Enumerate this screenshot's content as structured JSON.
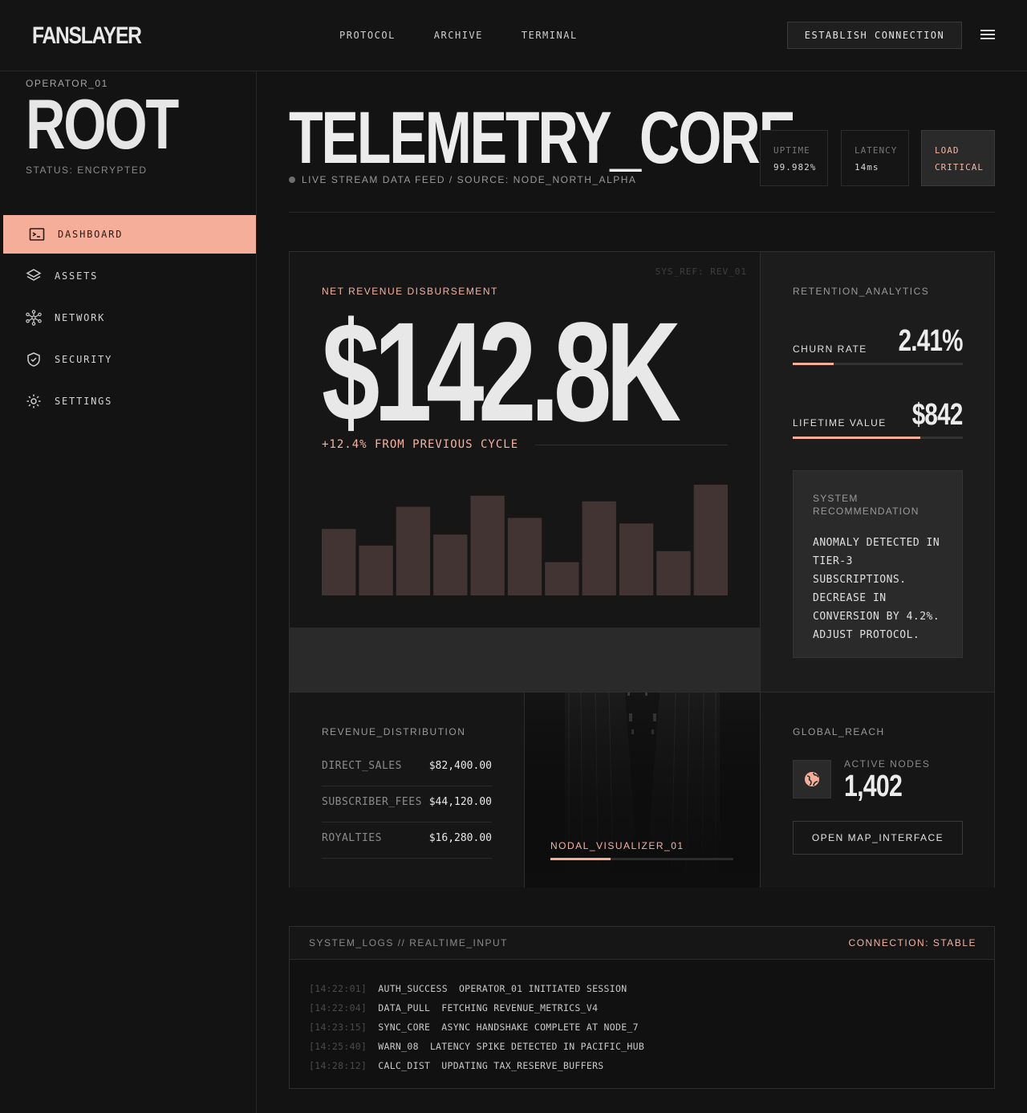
{
  "header": {
    "logo": "FANSLAYER",
    "nav": [
      "PROTOCOL",
      "ARCHIVE",
      "TERMINAL"
    ],
    "connect_label": "ESTABLISH CONNECTION"
  },
  "sidebar": {
    "operator": "OPERATOR_01",
    "role": "ROOT",
    "status": "STATUS: ENCRYPTED",
    "items": [
      {
        "label": "DASHBOARD",
        "icon": "terminal-icon",
        "active": true
      },
      {
        "label": "ASSETS",
        "icon": "layers-icon"
      },
      {
        "label": "NETWORK",
        "icon": "network-icon"
      },
      {
        "label": "SECURITY",
        "icon": "shield-icon"
      },
      {
        "label": "SETTINGS",
        "icon": "gear-icon"
      }
    ]
  },
  "main": {
    "title": "TELEMETRY_CORE",
    "subtitle": "LIVE STREAM DATA FEED / SOURCE: NODE_NORTH_ALPHA",
    "stats": [
      {
        "key": "UPTIME",
        "value": "99.982%"
      },
      {
        "key": "LATENCY",
        "value": "14ms"
      },
      {
        "key": "LOAD",
        "value": "CRITICAL",
        "alert": true
      }
    ]
  },
  "revenue": {
    "sys_ref": "SYS_REF: REV_01",
    "label": "NET REVENUE DISBURSEMENT",
    "value": "$142.8K",
    "change": "+12.4% FROM PREVIOUS CYCLE"
  },
  "chart_data": {
    "type": "bar",
    "values": [
      60,
      45,
      80,
      55,
      90,
      70,
      30,
      85,
      65,
      40,
      100
    ],
    "ylim": [
      0,
      100
    ]
  },
  "retention": {
    "label": "RETENTION_ANALYTICS",
    "churn": {
      "name": "CHURN RATE",
      "value": "2.41%",
      "fill": 0.24
    },
    "ltv": {
      "name": "LIFETIME VALUE",
      "value": "$842",
      "fill": 0.75
    },
    "rec_title": "SYSTEM RECOMMENDATION",
    "rec_text": "ANOMALY DETECTED IN TIER-3 SUBSCRIPTIONS. DECREASE IN CONVERSION BY 4.2%. ADJUST PROTOCOL."
  },
  "distribution": {
    "label": "REVENUE_DISTRIBUTION",
    "rows": [
      {
        "key": "DIRECT_SALES",
        "value": "$82,400.00"
      },
      {
        "key": "SUBSCRIBER_FEES",
        "value": "$44,120.00"
      },
      {
        "key": "ROYALTIES",
        "value": "$16,280.00"
      }
    ]
  },
  "visualizer": {
    "label": "NODAL_VISUALIZER_01",
    "progress": 0.33
  },
  "reach": {
    "label": "GLOBAL_REACH",
    "nodes_label": "ACTIVE NODES",
    "nodes_value": "1,402",
    "map_button": "OPEN MAP_INTERFACE"
  },
  "logs": {
    "title": "SYSTEM_LOGS // REALTIME_INPUT",
    "status": "CONNECTION: STABLE",
    "lines": [
      {
        "ts": "[14:22:01]",
        "code": "AUTH_SUCCESS",
        "msg": "OPERATOR_01 INITIATED SESSION"
      },
      {
        "ts": "[14:22:04]",
        "code": "DATA_PULL",
        "msg": "FETCHING REVENUE_METRICS_V4"
      },
      {
        "ts": "[14:23:15]",
        "code": "SYNC_CORE",
        "msg": "ASYNC HANDSHAKE COMPLETE AT NODE_7"
      },
      {
        "ts": "[14:25:40]",
        "code": "WARN_08",
        "msg": "LATENCY SPIKE DETECTED IN PACIFIC_HUB"
      },
      {
        "ts": "[14:28:12]",
        "code": "CALC_DIST",
        "msg": "UPDATING TAX_RESERVE_BUFFERS"
      }
    ]
  },
  "colors": {
    "accent": "#f5ae99",
    "background": "#131314",
    "bar": "#423432"
  }
}
